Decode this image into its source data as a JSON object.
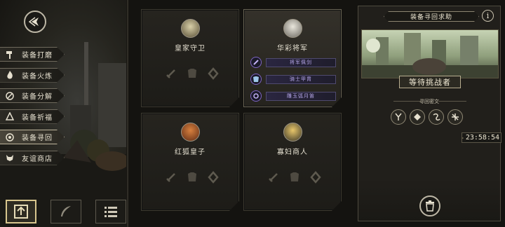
{
  "menu": [
    {
      "label": "装备打磨",
      "icon": "hammer-icon",
      "active": false
    },
    {
      "label": "装备火炼",
      "icon": "flame-icon",
      "active": false
    },
    {
      "label": "装备分解",
      "icon": "disassemble-icon",
      "active": false
    },
    {
      "label": "装备祈福",
      "icon": "blessing-icon",
      "active": false
    },
    {
      "label": "装备寻回",
      "icon": "recover-icon",
      "active": true
    },
    {
      "label": "友谊商店",
      "icon": "fox-shop-icon",
      "active": false
    }
  ],
  "bottom_bar": [
    {
      "icon": "upload-icon",
      "active": true
    },
    {
      "icon": "feather-icon",
      "active": false
    },
    {
      "icon": "list-icon",
      "active": false
    }
  ],
  "cards": [
    {
      "name": "皇家守卫",
      "portrait": "royal-guard-portrait",
      "selected": false
    },
    {
      "name": "华彩将军",
      "portrait": "general-portrait",
      "selected": true,
      "gear": [
        {
          "label": "将军佩剑",
          "icon": "sword-icon"
        },
        {
          "label": "骑士甲胄",
          "icon": "armor-icon"
        },
        {
          "label": "雕玉弧月笛",
          "icon": "flute-icon"
        }
      ]
    },
    {
      "name": "红狐皇子",
      "portrait": "fox-prince-portrait",
      "selected": false
    },
    {
      "name": "寡妇商人",
      "portrait": "widow-merchant-portrait",
      "selected": false
    }
  ],
  "panel": {
    "title": "装备寻回求助",
    "info_label": "i",
    "boss_name": "等待挑战者",
    "rune_title": "寻回密文",
    "timer": "23:58:54",
    "runes": [
      "rune-y-icon",
      "rune-diamond-icon",
      "rune-swirl-icon",
      "rune-cross-icon"
    ]
  },
  "colors": {
    "accent": "#d8c68e",
    "gear_purple": "#7e64c2"
  }
}
